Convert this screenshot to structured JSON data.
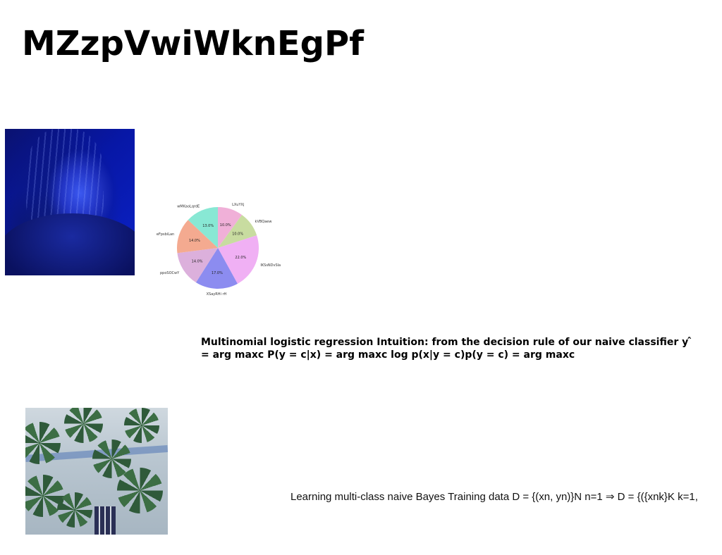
{
  "slide": {
    "title": "MZzpVwiWknEgPf",
    "text_1": "Multinomial logistic regression Intuition: from the decision rule of our naive classifier y ̂ = arg maxc P(y = c|x) = arg maxc log p(x|y = c)p(y = c) = arg maxc",
    "text_2": "Learning multi-class naive Bayes Training data D = {(xn, yn)}N n=1 ⇒ D = {({xnk}K k=1,"
  },
  "images": {
    "portrait": "person-with-hands-on-head-blue-photo",
    "palms": "aerial-palm-trees-photo"
  },
  "chart_data": {
    "type": "pie",
    "title": "",
    "slices": [
      {
        "label": "LXuYXj",
        "value": 10.0,
        "pct_text": "10.0%",
        "color": "#f0b0d8"
      },
      {
        "label": "kVBQaew",
        "value": 10.0,
        "pct_text": "10.0%",
        "color": "#c8dca0"
      },
      {
        "label": "IKSsNDvSla",
        "value": 22.0,
        "pct_text": "22.0%",
        "color": "#f0b0f4"
      },
      {
        "label": "XSayRHi rH",
        "value": 17.0,
        "pct_text": "17.0%",
        "color": "#8c8cf0"
      },
      {
        "label": "ppoSOCwY",
        "value": 14.0,
        "pct_text": "14.0%",
        "color": "#dcb0dc"
      },
      {
        "label": "eFpsbiLan",
        "value": 14.0,
        "pct_text": "14.0%",
        "color": "#f4aa90"
      },
      {
        "label": "wMKaoLqrdE",
        "value": 13.0,
        "pct_text": "13.0%",
        "color": "#88e8d4"
      }
    ],
    "start_angle": "top",
    "direction": "clockwise",
    "legend": "none"
  }
}
